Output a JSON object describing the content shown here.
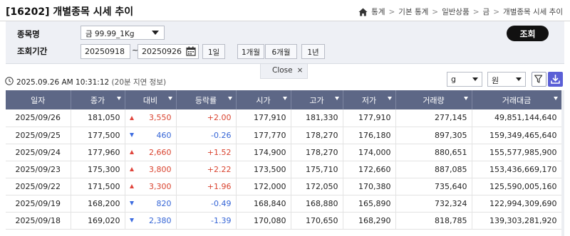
{
  "header": {
    "title": "[16202] 개별종목 시세 추이",
    "breadcrumb": [
      "통계",
      "기본 통계",
      "일반상품",
      "금",
      "개별종목 시세 추이"
    ]
  },
  "filters": {
    "item_label": "종목명",
    "item_value": "금 99.99_1Kg",
    "period_label": "조회기간",
    "start_date": "20250918",
    "end_date": "20250926",
    "tilde": "~",
    "period_buttons": [
      "1일",
      "1개월",
      "6개월",
      "1년"
    ],
    "search_label": "조회"
  },
  "close_tab": {
    "label": "Close",
    "x": "×"
  },
  "info": {
    "timestamp": "2025.09.26 AM 10:31:12",
    "delay_note": "(20분 지연 정보)",
    "unit_weight": "g",
    "unit_currency": "원"
  },
  "table": {
    "columns": [
      "일자",
      "종가",
      "대비",
      "등락률",
      "시가",
      "고가",
      "저가",
      "거래량",
      "거래대금"
    ],
    "rows": [
      {
        "date": "2025/09/26",
        "close": "181,050",
        "dir": "up",
        "change": "3,550",
        "rate": "+2.00",
        "open": "177,910",
        "high": "181,330",
        "low": "177,910",
        "volume": "277,145",
        "amount": "49,851,144,640"
      },
      {
        "date": "2025/09/25",
        "close": "177,500",
        "dir": "down",
        "change": "460",
        "rate": "-0.26",
        "open": "177,770",
        "high": "178,270",
        "low": "176,180",
        "volume": "897,305",
        "amount": "159,349,465,640"
      },
      {
        "date": "2025/09/24",
        "close": "177,960",
        "dir": "up",
        "change": "2,660",
        "rate": "+1.52",
        "open": "174,900",
        "high": "178,270",
        "low": "174,000",
        "volume": "880,651",
        "amount": "155,577,985,900"
      },
      {
        "date": "2025/09/23",
        "close": "175,300",
        "dir": "up",
        "change": "3,800",
        "rate": "+2.22",
        "open": "173,500",
        "high": "175,710",
        "low": "172,660",
        "volume": "887,085",
        "amount": "153,436,669,170"
      },
      {
        "date": "2025/09/22",
        "close": "171,500",
        "dir": "up",
        "change": "3,300",
        "rate": "+1.96",
        "open": "172,000",
        "high": "172,050",
        "low": "170,380",
        "volume": "735,640",
        "amount": "125,590,005,160"
      },
      {
        "date": "2025/09/19",
        "close": "168,200",
        "dir": "down",
        "change": "820",
        "rate": "-0.49",
        "open": "168,840",
        "high": "168,880",
        "low": "165,890",
        "volume": "732,324",
        "amount": "122,994,309,690"
      },
      {
        "date": "2025/09/18",
        "close": "169,020",
        "dir": "down",
        "change": "2,380",
        "rate": "-1.39",
        "open": "170,080",
        "high": "170,650",
        "low": "168,290",
        "volume": "818,785",
        "amount": "139,303,281,920"
      }
    ]
  },
  "colors": {
    "up": "#d9432f",
    "down": "#3565d6",
    "header_bg": "#5d6786",
    "accent": "#5b5fd6"
  }
}
